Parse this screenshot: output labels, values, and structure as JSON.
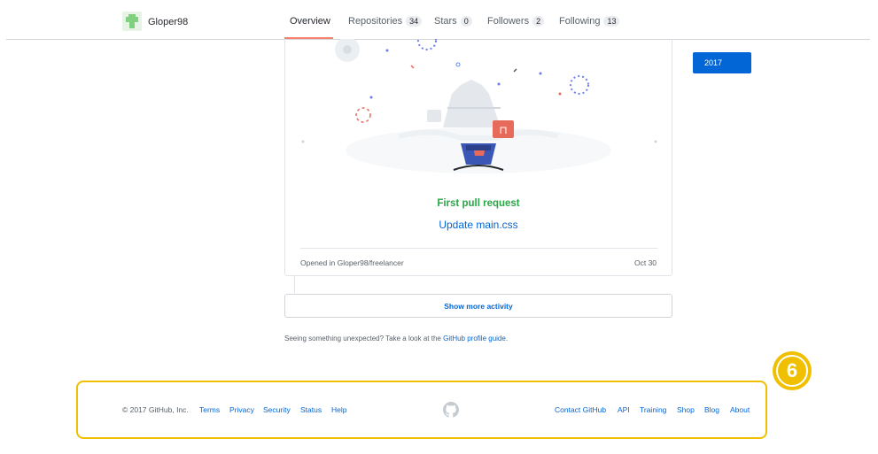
{
  "header": {
    "username": "Gloper98",
    "tabs": [
      {
        "label": "Overview",
        "count": null,
        "selected": true
      },
      {
        "label": "Repositories",
        "count": "34"
      },
      {
        "label": "Stars",
        "count": "0"
      },
      {
        "label": "Followers",
        "count": "2"
      },
      {
        "label": "Following",
        "count": "13"
      }
    ]
  },
  "sidebar": {
    "year": "2017"
  },
  "activity": {
    "title": "First pull request",
    "pr_link": "Update main.css",
    "opened_in": "Opened in Gloper98/freelancer",
    "date": "Oct 30",
    "show_more": "Show more activity"
  },
  "note": {
    "prefix": "Seeing something unexpected? Take a look at the",
    "link": "GitHub profile guide",
    "suffix": "."
  },
  "footer": {
    "copyright": "© 2017 GitHub, Inc.",
    "left_links": [
      "Terms",
      "Privacy",
      "Security",
      "Status",
      "Help"
    ],
    "right_links": [
      "Contact GitHub",
      "API",
      "Training",
      "Shop",
      "Blog",
      "About"
    ]
  },
  "annotation": {
    "number": "6",
    "color": "#f0c000"
  },
  "colors": {
    "accent": "#0366d6",
    "success": "#28a745",
    "tab_underline": "#f9826c"
  }
}
